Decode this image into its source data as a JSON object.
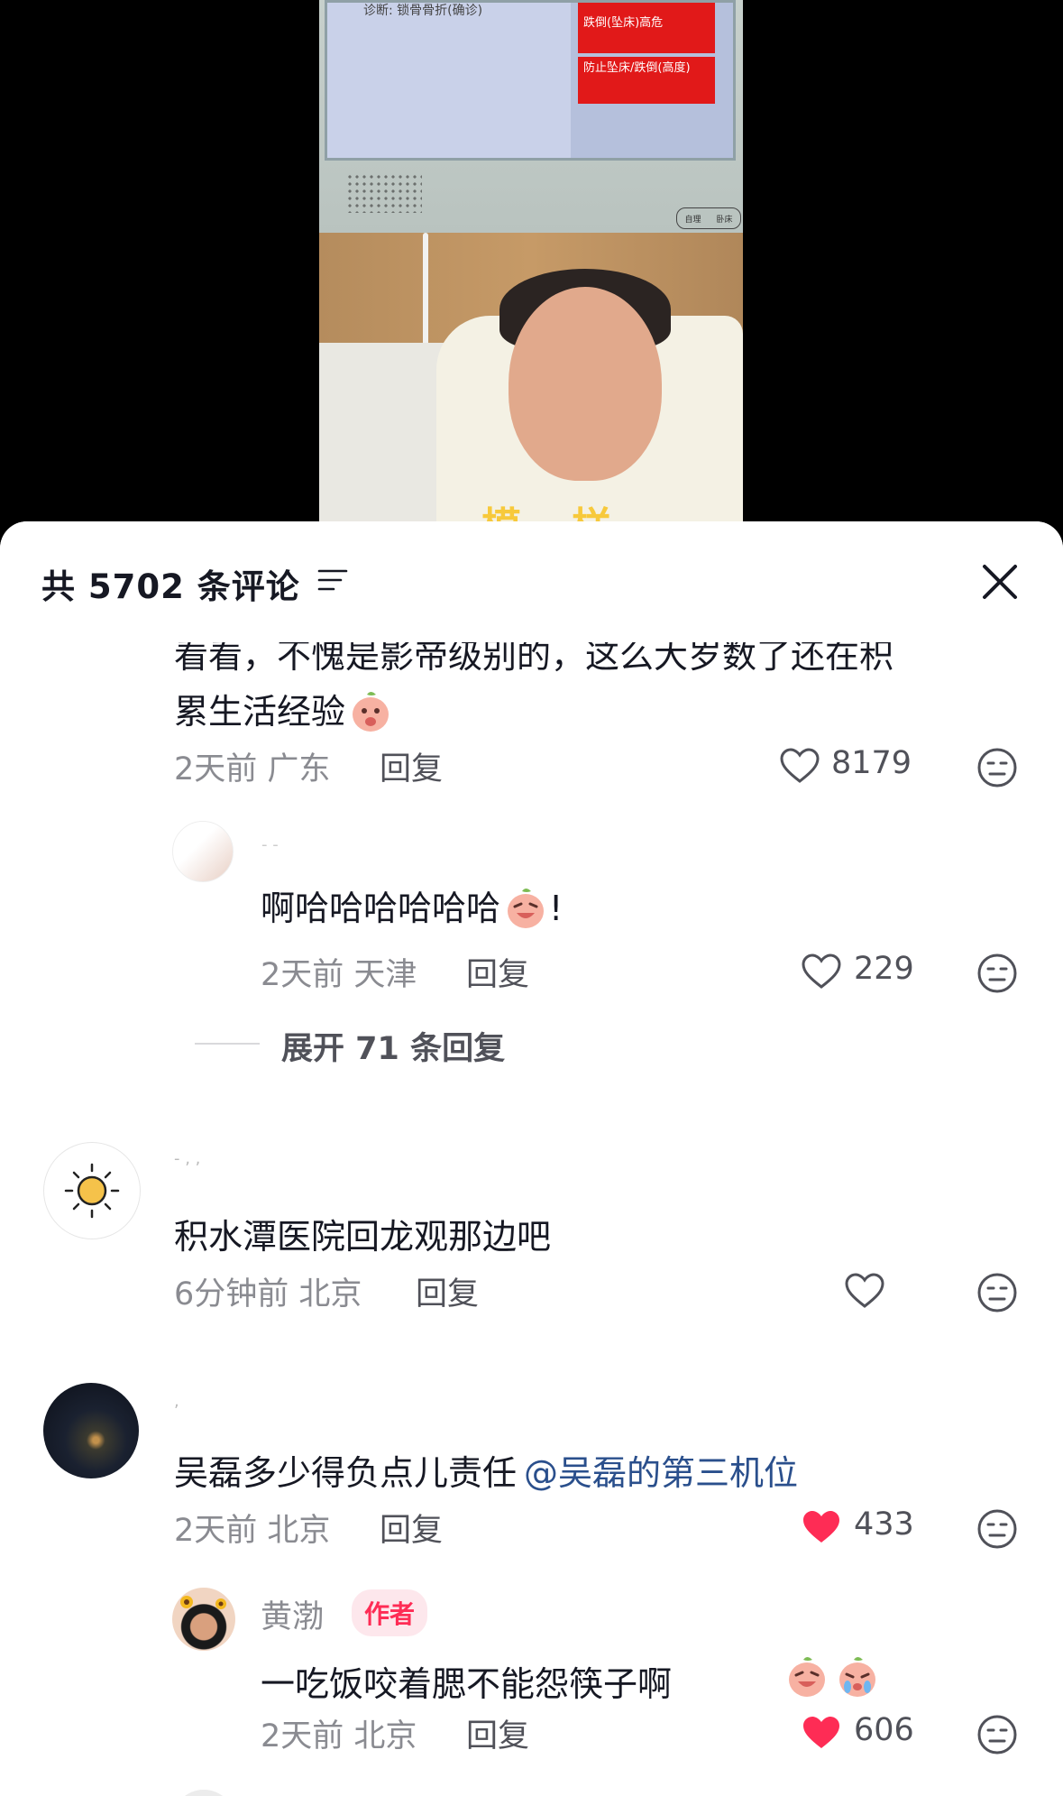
{
  "video": {
    "diagnosis_text": "诊断: 锁骨骨折(确诊)",
    "red_label_1": "跌倒(坠床)高危",
    "red_label_2": "防止坠床/跌倒(高度)",
    "mini_buttons": [
      "自理",
      "卧床"
    ],
    "subtitle": "一模一样"
  },
  "header": {
    "title": "共 5702 条评论"
  },
  "comments": [
    {
      "text_line1": "看看，不愧是影帝级别的，这么大岁数了还在积",
      "text_line2": "累生活经验",
      "time": "2天前",
      "location": "广东",
      "reply_label": "回复",
      "likes": "8179",
      "liked": false,
      "replies": [
        {
          "text": "啊哈哈哈哈哈哈",
          "text_suffix": "!",
          "time": "2天前",
          "location": "天津",
          "reply_label": "回复",
          "likes": "229",
          "liked": false
        }
      ],
      "expand_label": "展开 71 条回复"
    },
    {
      "text": "积水潭医院回龙观那边吧",
      "time": "6分钟前",
      "location": "北京",
      "reply_label": "回复",
      "likes": "",
      "liked": false
    },
    {
      "text": "吴磊多少得负点儿责任",
      "mention": "@吴磊的第三机位",
      "time": "2天前",
      "location": "北京",
      "reply_label": "回复",
      "likes": "433",
      "liked": true,
      "replies": [
        {
          "author": "黄渤",
          "badge": "作者",
          "text": "一吃饭咬着腮不能怨筷子啊",
          "time": "2天前",
          "location": "北京",
          "reply_label": "回复",
          "likes": "606",
          "liked": true
        }
      ]
    }
  ],
  "colors": {
    "like_red": "#fe2c55",
    "text_dark": "#161823",
    "text_gray": "#8a8b91",
    "mention_blue": "#2a4f8c"
  }
}
